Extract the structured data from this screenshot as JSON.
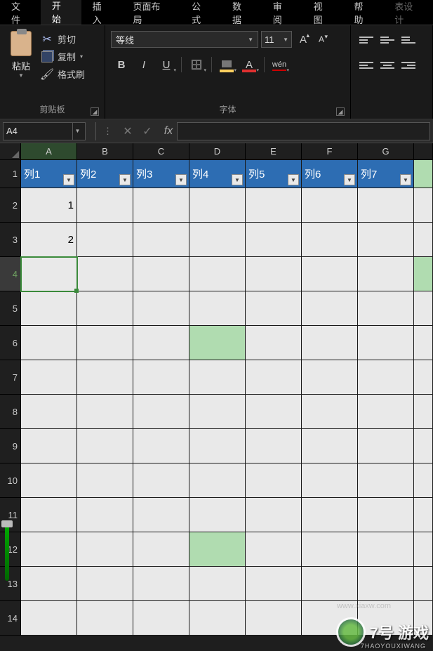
{
  "menu": {
    "file": "文件",
    "home": "开始",
    "insert": "插入",
    "pageLayout": "页面布局",
    "formulas": "公式",
    "data": "数据",
    "review": "审阅",
    "view": "视图",
    "help": "帮助",
    "tableDesign": "表设计"
  },
  "ribbon": {
    "clipboard": {
      "paste": "粘贴",
      "cut": "剪切",
      "copy": "复制",
      "formatPainter": "格式刷",
      "groupLabel": "剪贴板"
    },
    "font": {
      "name": "等线",
      "size": "11",
      "bold": "B",
      "italic": "I",
      "underline": "U",
      "fontColorLetter": "A",
      "pinyin": "wén",
      "groupLabel": "字体"
    }
  },
  "nameBox": "A4",
  "fx": "fx",
  "columns": [
    "A",
    "B",
    "C",
    "D",
    "E",
    "F",
    "G"
  ],
  "rows": [
    "1",
    "2",
    "3",
    "4",
    "5",
    "6",
    "7",
    "8",
    "9",
    "10",
    "11",
    "12",
    "13",
    "14"
  ],
  "tableHeaders": [
    "列1",
    "列2",
    "列3",
    "列4",
    "列5",
    "列6",
    "列7"
  ],
  "dataCells": {
    "A2": "1",
    "A3": "2"
  },
  "selectedCell": "A4",
  "watermark": {
    "text": "7号 游戏",
    "sub": "7HAOYOUXIWANG",
    "url": "www.xiaxw.com"
  }
}
